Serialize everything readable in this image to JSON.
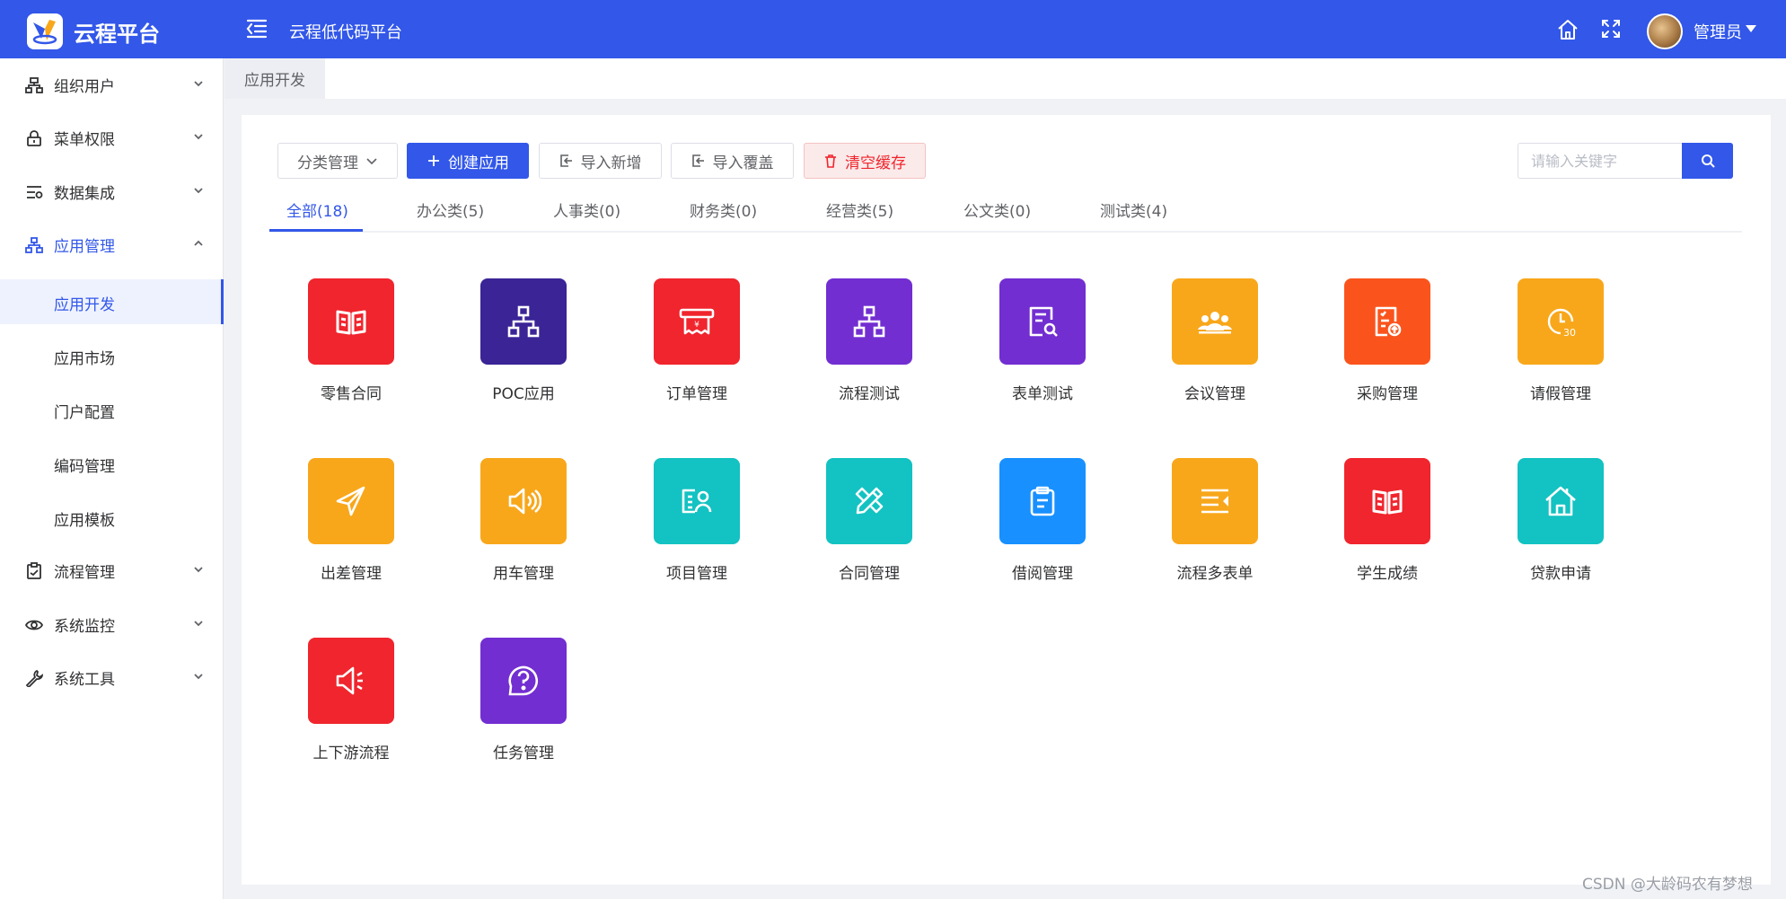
{
  "header": {
    "logo_text": "云程平台",
    "site_title": "云程低代码平台",
    "user_name": "管理员",
    "bg_color": "#3257e9"
  },
  "sidebar": {
    "items": [
      {
        "label": "组织用户",
        "icon": "org-icon"
      },
      {
        "label": "菜单权限",
        "icon": "lock-icon"
      },
      {
        "label": "数据集成",
        "icon": "data-icon"
      },
      {
        "label": "应用管理",
        "icon": "app-tree-icon",
        "active": true
      },
      {
        "label": "流程管理",
        "icon": "clipboard-icon"
      },
      {
        "label": "系统监控",
        "icon": "eye-icon"
      },
      {
        "label": "系统工具",
        "icon": "wrench-icon"
      }
    ],
    "sub_items": [
      {
        "label": "应用开发",
        "selected": true
      },
      {
        "label": "应用市场"
      },
      {
        "label": "门户配置"
      },
      {
        "label": "编码管理"
      },
      {
        "label": "应用模板"
      }
    ]
  },
  "tabs": {
    "current": "应用开发"
  },
  "toolbar": {
    "category_label": "分类管理",
    "create_label": "创建应用",
    "import_label": "导入新增",
    "cover_label": "导入覆盖",
    "clear_label": "清空缓存",
    "search_placeholder": "请输入关键字"
  },
  "categories": [
    {
      "label": "全部(18)",
      "active": true
    },
    {
      "label": "办公类(5)"
    },
    {
      "label": "人事类(0)"
    },
    {
      "label": "财务类(0)"
    },
    {
      "label": "经营类(5)"
    },
    {
      "label": "公文类(0)"
    },
    {
      "label": "测试类(4)"
    }
  ],
  "apps": [
    {
      "label": "零售合同",
      "color": "#f0252d",
      "icon": "book-icon"
    },
    {
      "label": "POC应用",
      "color": "#3a2496",
      "icon": "hierarchy-icon"
    },
    {
      "label": "订单管理",
      "color": "#f0252d",
      "icon": "receipt-icon"
    },
    {
      "label": "流程测试",
      "color": "#722ed1",
      "icon": "hierarchy-icon"
    },
    {
      "label": "表单测试",
      "color": "#722ed1",
      "icon": "form-search-icon"
    },
    {
      "label": "会议管理",
      "color": "#f8a71b",
      "icon": "meeting-icon"
    },
    {
      "label": "采购管理",
      "color": "#fa541c",
      "icon": "purchase-icon"
    },
    {
      "label": "请假管理",
      "color": "#f8a71b",
      "icon": "clock-30-icon"
    },
    {
      "label": "出差管理",
      "color": "#f8a71b",
      "icon": "paper-plane-icon"
    },
    {
      "label": "用车管理",
      "color": "#f8a71b",
      "icon": "speaker-icon"
    },
    {
      "label": "项目管理",
      "color": "#13c2c2",
      "icon": "profile-card-icon"
    },
    {
      "label": "合同管理",
      "color": "#13c2c2",
      "icon": "pencil-ruler-icon"
    },
    {
      "label": "借阅管理",
      "color": "#1890ff",
      "icon": "clipboard-list-icon"
    },
    {
      "label": "流程多表单",
      "color": "#f8a71b",
      "icon": "menu-fold-icon"
    },
    {
      "label": "学生成绩",
      "color": "#f0252d",
      "icon": "book-icon"
    },
    {
      "label": "贷款申请",
      "color": "#13c2c2",
      "icon": "house-icon"
    },
    {
      "label": "上下游流程",
      "color": "#f0252d",
      "icon": "megaphone-icon"
    },
    {
      "label": "任务管理",
      "color": "#722ed1",
      "icon": "question-icon"
    }
  ],
  "watermark": "CSDN @大龄码农有梦想"
}
